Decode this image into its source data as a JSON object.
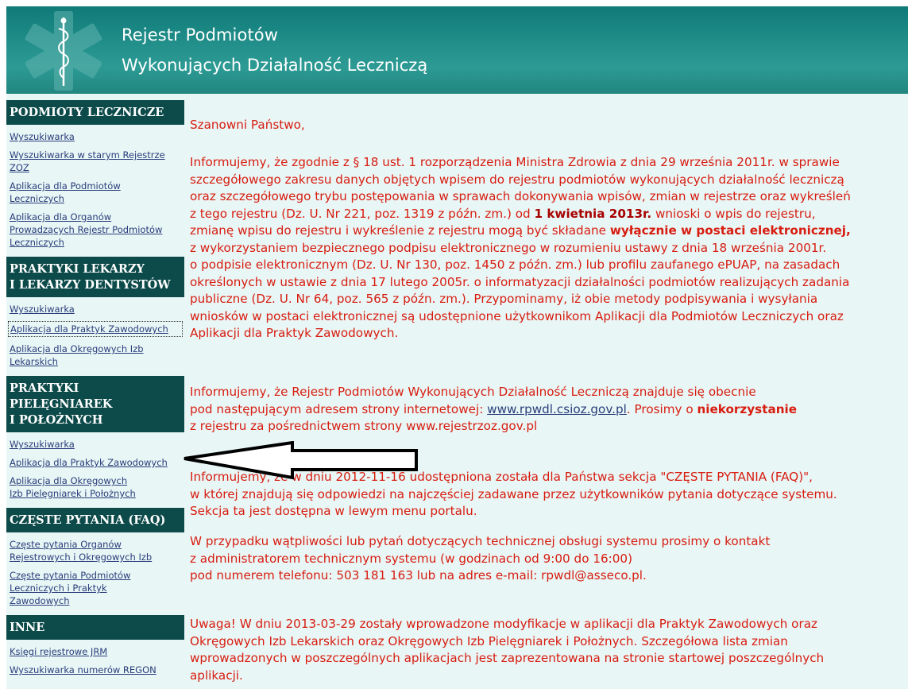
{
  "header": {
    "title_line1": "Rejestr Podmiotów",
    "title_line2": "Wykonujących Działalność Leczniczą",
    "logo_icon": "caduceus-star-icon"
  },
  "sidebar": {
    "sections": [
      {
        "heading_lines": [
          "PODMIOTY LECZNICZE"
        ],
        "links": [
          [
            "Wyszukiwarka"
          ],
          [
            "Wyszukiwarka w starym Rejestrze",
            "ZOZ"
          ],
          [
            "Aplikacja dla Podmiotów",
            "Leczniczych"
          ],
          [
            "Aplikacja dla Organów",
            "Prowadzących Rejestr Podmiotów",
            "Leczniczych"
          ]
        ]
      },
      {
        "heading_lines": [
          "PRAKTYKI LEKARZY",
          "I LEKARZY DENTYSTÓW"
        ],
        "links": [
          [
            "Wyszukiwarka"
          ],
          [
            "Aplikacja dla Praktyk Zawodowych"
          ],
          [
            "Aplikacja dla Okręgowych Izb",
            "Lekarskich"
          ]
        ]
      },
      {
        "heading_lines": [
          "PRAKTYKI PIELĘGNIAREK",
          "I POŁOŻNYCH"
        ],
        "links": [
          [
            "Wyszukiwarka"
          ],
          [
            "Aplikacja dla Praktyk Zawodowych"
          ],
          [
            "Aplikacja dla Okręgowych",
            "Izb Pielęgniarek i Położnych"
          ]
        ]
      },
      {
        "heading_lines": [
          "CZĘSTE PYTANIA (FAQ)"
        ],
        "links": [
          [
            "Częste pytania Organów",
            "Rejestrowych i Okręgowych Izb"
          ],
          [
            "Częste pytania Podmiotów",
            "Leczniczych i Praktyk",
            "Zawodowych"
          ]
        ]
      },
      {
        "heading_lines": [
          "INNE"
        ],
        "links": [
          [
            "Księgi rejestrowe JRM"
          ],
          [
            "Wyszukiwarka numerów REGON"
          ]
        ]
      }
    ]
  },
  "content": {
    "greeting": "Szanowni Państwo,",
    "p1": [
      [
        "Informujemy, że zgodnie z § 18 ust. 1 rozporządzenia Ministra Zdrowia z dnia 29 września 2011r. w sprawie"
      ],
      [
        "szczegółowego zakresu danych objętych wpisem do rejestru podmiotów wykonujących działalność leczniczą"
      ],
      [
        "oraz szczegółowego trybu postępowania w sprawach dokonywania wpisów, zmian w rejestrze oraz wykreśleń"
      ],
      [
        "z tego rejestru (Dz. U. Nr 221, poz. 1319 z późn. zm.) od ",
        "1 kwietnia 2013r.",
        " wnioski o wpis do rejestru,"
      ],
      [
        "zmianę wpisu do rejestru i wykreślenie z rejestru mogą być składane ",
        "wyłącznie w postaci elektronicznej,"
      ],
      [
        "z wykorzystaniem bezpiecznego podpisu elektronicznego w rozumieniu ustawy z dnia 18 września 2001r."
      ],
      [
        "o podpisie elektronicznym (Dz. U. Nr 130, poz. 1450 z późn. zm.) lub profilu zaufanego ePUAP, na zasadach"
      ],
      [
        "określonych w ustawie z dnia 17 lutego 2005r. o informatyzacji działalności podmiotów realizujących zadania"
      ],
      [
        "publiczne (Dz. U. Nr 64, poz. 565 z późn. zm.). Przypominamy, iż obie metody podpisywania i wysyłania"
      ],
      [
        "wniosków w postaci elektronicznej są udostępnione użytkownikom Aplikacji dla Podmiotów Leczniczych oraz"
      ],
      [
        "Aplikacji dla Praktyk Zawodowych."
      ]
    ],
    "p2": {
      "line1": "Informujemy, że Rejestr Podmiotów Wykonujących Działalność Leczniczą znajduje się obecnie",
      "line2_pre": "pod następującym adresem strony internetowej: ",
      "link": "www.rpwdl.csioz.gov.pl",
      "line2_mid": ". Prosimy o ",
      "line2_bold": "niekorzystanie",
      "line3": "z rejestru za pośrednictwem strony www.rejestrzoz.gov.pl"
    },
    "p3": [
      "Informujemy, że w dniu 2012-11-16 udostępniona została dla Państwa sekcja \"CZĘSTE PYTANIA (FAQ)\",",
      "w której znajdują się odpowiedzi na najczęściej zadawane przez użytkowników pytania dotyczące systemu.",
      "Sekcja ta jest dostępna w lewym menu portalu."
    ],
    "p4": [
      "W przypadku wątpliwości lub pytań dotyczących technicznej obsługi systemu prosimy o kontakt",
      "z administratorem technicznym systemu (w godzinach od 9:00 do 16:00)",
      "pod numerem telefonu: 503 181 163 lub na adres e-mail: rpwdl@asseco.pl."
    ],
    "p5": [
      "Uwaga! W dniu 2013-03-29 zostały wprowadzone modyfikacje w aplikacji dla Praktyk Zawodowych oraz",
      "Okręgowych Izb Lekarskich oraz Okręgowych Izb Pielęgniarek i Położnych. Szczegółowa lista zmian",
      "wprowadzonych w poszczególnych aplikacjach jest zaprezentowana na stronie startowej poszczególnych",
      "aplikacji."
    ]
  },
  "annotation": {
    "arrow_icon": "left-arrow-annotation-icon"
  }
}
